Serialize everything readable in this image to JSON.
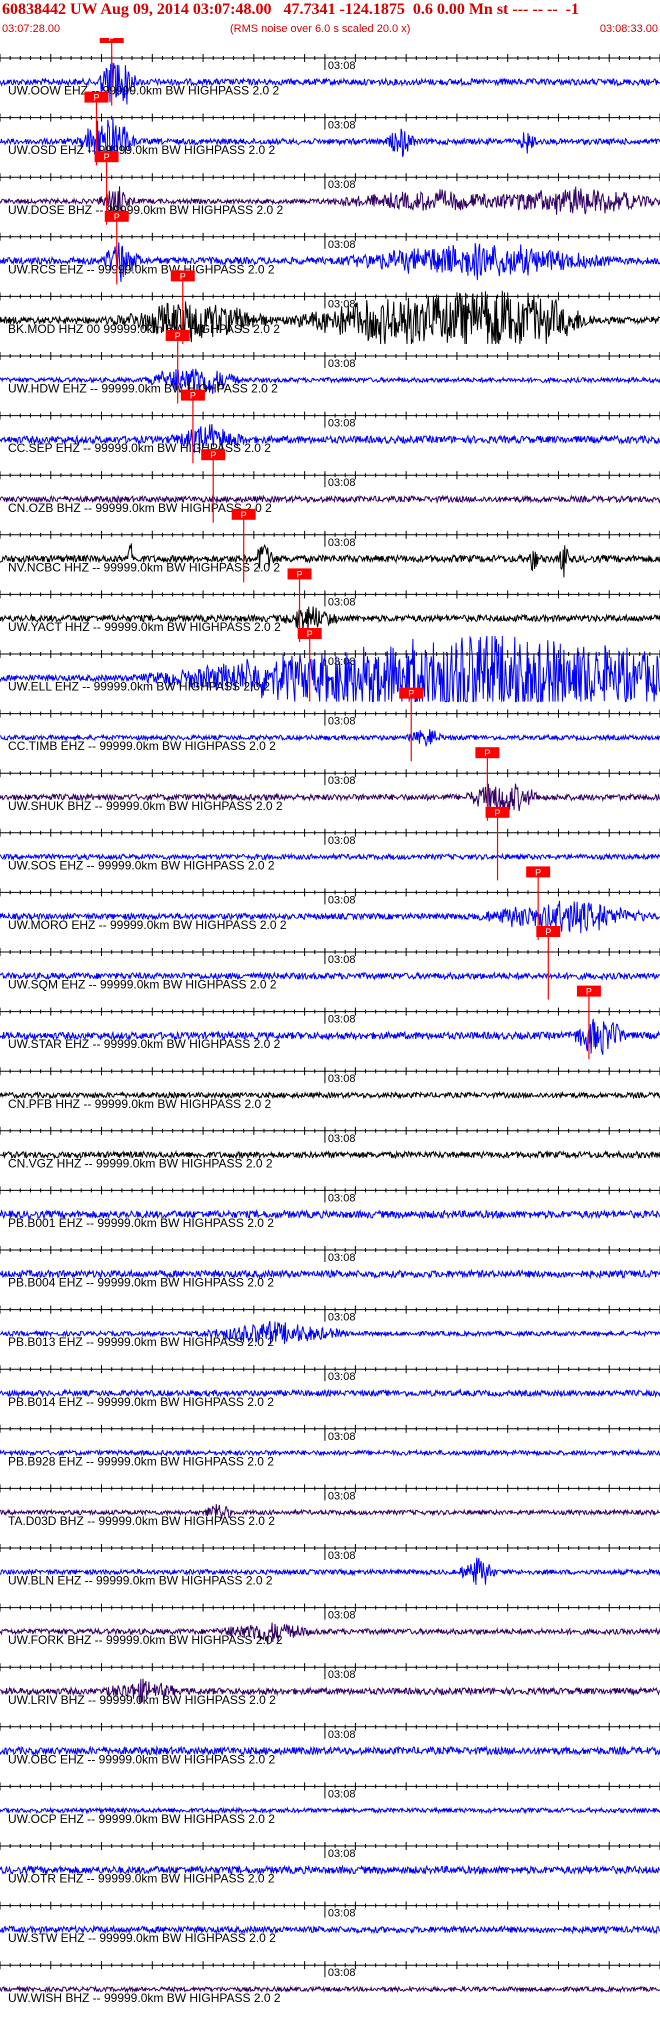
{
  "header": {
    "title": "60838442 UW Aug 09, 2014 03:07:48.00   47.7341 -124.1875  0.6 0.00 Mn st --- -- --  -1",
    "start_time": "03:07:28.00",
    "scale_note": "(RMS noise over 6.0 s scaled 20.0 x)",
    "end_time": "03:08:33.00"
  },
  "colors": {
    "blue": "#0000ff",
    "black": "#000000",
    "purple": "#330066",
    "red": "#ff0000",
    "header_red": "#d40000"
  },
  "chart_data": {
    "type": "waveform-record-section",
    "time_range": [
      "03:07:28.00",
      "03:08:33.00"
    ],
    "minute_marker_label": "03:08",
    "pick_label": "P",
    "traces": [
      {
        "label": "UW.OOW EHZ -- 99999.0km BW  HIGHPASS  2.0  2",
        "color": "blue",
        "pick_s": 11.0,
        "events": [
          {
            "t": 11.5,
            "amp": 6,
            "dur": 2
          }
        ]
      },
      {
        "label": "UW.OSD EHZ -- 99999.0km BW  HIGHPASS  2.0  2",
        "color": "blue",
        "pick_s": 9.5,
        "events": [
          {
            "t": 10.5,
            "amp": 5,
            "dur": 3
          },
          {
            "t": 39.5,
            "amp": 2.5,
            "dur": 1.5
          },
          {
            "t": 52.0,
            "amp": 2,
            "dur": 1
          }
        ]
      },
      {
        "label": "UW.DOSE BHZ -- 99999.0km BW  HIGHPASS  2.0  2",
        "color": "purple",
        "pick_s": 10.5,
        "events": [
          {
            "t": 11.5,
            "amp": 3,
            "dur": 2
          },
          {
            "t": 43,
            "amp": 2,
            "dur": 12
          },
          {
            "t": 57,
            "amp": 3,
            "dur": 9
          }
        ]
      },
      {
        "label": "UW.RCS EHZ -- 99999.0km BW  HIGHPASS  2.0  2",
        "color": "blue",
        "pick_s": 11.5,
        "events": [
          {
            "t": 12,
            "amp": 3,
            "dur": 2
          },
          {
            "t": 47,
            "amp": 2.5,
            "dur": 14
          }
        ]
      },
      {
        "label": "BK.MOD HHZ 00 99999.0km BW  HIGHPASS  2.0  2",
        "color": "black",
        "pick_s": 18.0,
        "events": [
          {
            "t": 19,
            "amp": 3,
            "dur": 8
          },
          {
            "t": 40,
            "amp": 4,
            "dur": 12
          },
          {
            "t": 51,
            "amp": 4.5,
            "dur": 8
          }
        ]
      },
      {
        "label": "UW.HDW EHZ -- 99999.0km BW  HIGHPASS  2.0  2",
        "color": "blue",
        "pick_s": 17.5,
        "events": [
          {
            "t": 19,
            "amp": 4,
            "dur": 5
          }
        ]
      },
      {
        "label": "CC.SEP EHZ -- 99999.0km BW  HIGHPASS  2.0  2",
        "color": "blue",
        "pick_s": 19.0,
        "events": [
          {
            "t": 20.5,
            "amp": 1.8,
            "dur": 4
          }
        ]
      },
      {
        "label": "CN.OZB BHZ -- 99999.0km BW  HIGHPASS  2.0  2",
        "color": "purple",
        "pick_s": 21.0,
        "events": []
      },
      {
        "label": "NV.NCBC HHZ -- 99999.0km BW  HIGHPASS  2.0  2",
        "color": "black",
        "pick_s": 24.0,
        "events": [
          {
            "t": 13,
            "amp": 3,
            "dur": 0.5
          },
          {
            "t": 26,
            "amp": 3,
            "dur": 1
          },
          {
            "t": 52.5,
            "amp": 3,
            "dur": 0.5
          },
          {
            "t": 55.5,
            "amp": 3,
            "dur": 0.5
          }
        ]
      },
      {
        "label": "UW.YACT HHZ -- 99999.0km BW  HIGHPASS  2.0  2",
        "color": "black",
        "pick_s": 29.5,
        "events": [
          {
            "t": 30.5,
            "amp": 2,
            "dur": 3
          }
        ]
      },
      {
        "label": "UW.ELL EHZ -- 99999.0km BW  HIGHPASS  2.0  2",
        "color": "blue",
        "pick_s": 30.5,
        "events": [
          {
            "t": 47,
            "amp": 8,
            "dur": 34
          }
        ]
      },
      {
        "label": "CC.TIMB EHZ -- 99999.0km BW  HIGHPASS  2.0  2",
        "color": "blue",
        "pick_s": 40.5,
        "events": [
          {
            "t": 42,
            "amp": 1.8,
            "dur": 2
          }
        ]
      },
      {
        "label": "UW.SHUK BHZ -- 99999.0km BW  HIGHPASS  2.0  2",
        "color": "purple",
        "pick_s": 48.0,
        "events": [
          {
            "t": 49.5,
            "amp": 3,
            "dur": 4
          }
        ]
      },
      {
        "label": "UW.SOS EHZ -- 99999.0km BW  HIGHPASS  2.0  2",
        "color": "blue",
        "pick_s": 49.0,
        "events": []
      },
      {
        "label": "UW.MORO EHZ -- 99999.0km BW  HIGHPASS  2.0  2",
        "color": "blue",
        "pick_s": 53.0,
        "events": [
          {
            "t": 55.5,
            "amp": 3,
            "dur": 9
          }
        ]
      },
      {
        "label": "UW.SQM EHZ -- 99999.0km BW  HIGHPASS  2.0  2",
        "color": "blue",
        "pick_s": 54.0,
        "events": []
      },
      {
        "label": "UW.STAR EHZ -- 99999.0km BW  HIGHPASS  2.0  2",
        "color": "blue",
        "pick_s": 58.0,
        "events": [
          {
            "t": 59,
            "amp": 3,
            "dur": 3
          }
        ]
      },
      {
        "label": "CN.PFB HHZ -- 99999.0km BW  HIGHPASS  2.0  2",
        "color": "black",
        "pick_s": null,
        "events": []
      },
      {
        "label": "CN.VGZ HHZ -- 99999.0km BW  HIGHPASS  2.0  2",
        "color": "black",
        "pick_s": null,
        "events": []
      },
      {
        "label": "PB.B001 EHZ -- 99999.0km BW  HIGHPASS  2.0  2",
        "color": "blue",
        "pick_s": null,
        "events": []
      },
      {
        "label": "PB.B004 EHZ -- 99999.0km BW  HIGHPASS  2.0  2",
        "color": "blue",
        "pick_s": null,
        "events": []
      },
      {
        "label": "PB.B013 EHZ -- 99999.0km BW  HIGHPASS  2.0  2",
        "color": "blue",
        "pick_s": null,
        "events": [
          {
            "t": 27,
            "amp": 2.5,
            "dur": 8
          }
        ]
      },
      {
        "label": "PB.B014 EHZ -- 99999.0km BW  HIGHPASS  2.0  2",
        "color": "blue",
        "pick_s": null,
        "events": []
      },
      {
        "label": "PB.B928 EHZ -- 99999.0km BW  HIGHPASS  2.0  2",
        "color": "blue",
        "pick_s": null,
        "events": []
      },
      {
        "label": "TA.D03D BHZ -- 99999.0km BW  HIGHPASS  2.0  2",
        "color": "purple",
        "pick_s": null,
        "events": [
          {
            "t": 21.5,
            "amp": 2.5,
            "dur": 1.5
          }
        ]
      },
      {
        "label": "UW.BLN EHZ -- 99999.0km BW  HIGHPASS  2.0  2",
        "color": "blue",
        "pick_s": null,
        "events": [
          {
            "t": 47,
            "amp": 3.5,
            "dur": 2
          }
        ]
      },
      {
        "label": "UW.FORK BHZ -- 99999.0km BW  HIGHPASS  2.0  2",
        "color": "purple",
        "pick_s": null,
        "events": [
          {
            "t": 26,
            "amp": 2,
            "dur": 5
          }
        ]
      },
      {
        "label": "UW.LRIV BHZ -- 99999.0km BW  HIGHPASS  2.0  2",
        "color": "purple",
        "pick_s": null,
        "events": [
          {
            "t": 14,
            "amp": 1.6,
            "dur": 4
          }
        ]
      },
      {
        "label": "UW.OBC EHZ -- 99999.0km BW  HIGHPASS  2.0  2",
        "color": "blue",
        "pick_s": null,
        "events": []
      },
      {
        "label": "UW.OCP EHZ -- 99999.0km BW  HIGHPASS  2.0  2",
        "color": "blue",
        "pick_s": null,
        "events": []
      },
      {
        "label": "UW.OTR EHZ -- 99999.0km BW  HIGHPASS  2.0  2",
        "color": "blue",
        "pick_s": null,
        "events": []
      },
      {
        "label": "UW.STW EHZ -- 99999.0km BW  HIGHPASS  2.0  2",
        "color": "blue",
        "pick_s": null,
        "events": []
      },
      {
        "label": "UW.WISH BHZ -- 99999.0km BW  HIGHPASS  2.0  2",
        "color": "purple",
        "pick_s": null,
        "events": []
      }
    ]
  }
}
